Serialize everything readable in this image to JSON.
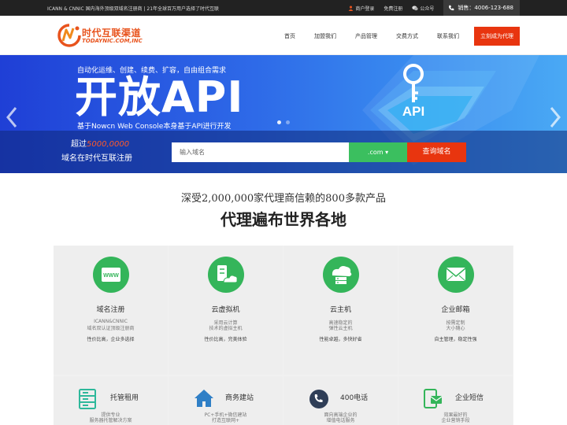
{
  "topbar": {
    "notice": "ICANN & CNNIC 国内海外顶级双域名注册商 | 21年全球百万用户选择了时代互联",
    "merchant_login": "商户登录",
    "free_register": "免费注册",
    "wechat": "公众号",
    "phone": "销售：4006-123-688"
  },
  "header": {
    "logo_cn": "时代互联渠道",
    "logo_en": "TODAYNIC.COM,INC",
    "nav": [
      "首页",
      "加盟我们",
      "产品管理",
      "交费方式",
      "联系我们"
    ],
    "cta": "立刻成为代理"
  },
  "banner": {
    "subtitle": "自动化运维、创建、续费、扩容，自由组合需求",
    "headline": "开放API",
    "description": "基于Nowcn Web Console本身基于API进行开发",
    "api_label": "API"
  },
  "search": {
    "line1_prefix": "超过",
    "line1_number": "5000,0000",
    "line2": "域名在时代互联注册",
    "placeholder": "输入域名",
    "suffix": ".com ▾",
    "button": "查询域名"
  },
  "intro": {
    "line1": "深受2,000,000家代理商信赖的800多款产品",
    "line2": "代理遍布世界各地"
  },
  "products": [
    {
      "title": "域名注册",
      "desc1": "ICANN&CNNIC",
      "desc2": "域名双认证顶级注册商",
      "tag": "性价比高，企业多选择",
      "icon": "www-icon"
    },
    {
      "title": "云虚拟机",
      "desc1": "采用云计算",
      "desc2": "技术的虚拟主机",
      "tag": "性价比高，完美体验",
      "icon": "cloud-server-icon"
    },
    {
      "title": "云主机",
      "desc1": "高速稳定的",
      "desc2": "弹性云主机",
      "tag": "性能卓越，多快好省",
      "icon": "database-cloud-icon"
    },
    {
      "title": "企业邮箱",
      "desc1": "按需定制",
      "desc2": "大小随心",
      "tag": "自主管理，稳定性强",
      "icon": "mail-icon"
    }
  ],
  "products2": [
    {
      "title": "托管租用",
      "desc1": "提供专业",
      "desc2": "服务器托管解决方案",
      "icon": "server-rack-icon"
    },
    {
      "title": "商务建站",
      "desc1": "PC+手机+微信建站",
      "desc2": "打造互联网+",
      "icon": "house-icon"
    },
    {
      "title": "400电话",
      "desc1": "面向高端企业的",
      "desc2": "增值电话服务",
      "icon": "phone-400-icon"
    },
    {
      "title": "企业短信",
      "desc1": "效果最好的",
      "desc2": "企业营销手段",
      "icon": "sms-icon"
    }
  ],
  "colors": {
    "accent": "#e8350f",
    "green": "#34b55a",
    "banner_blue": "#2e6ae8"
  }
}
